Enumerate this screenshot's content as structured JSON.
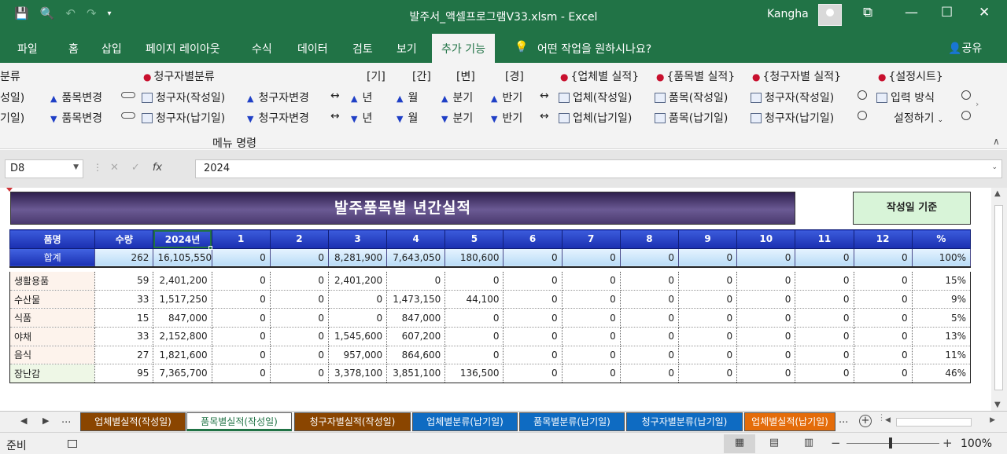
{
  "window": {
    "title": "발주서_액셀프로그램V33.xlsm  -  Excel",
    "user": "Kangha",
    "controls": [
      "ribbon-display-icon",
      "minimize-icon",
      "maximize-icon",
      "close-icon"
    ]
  },
  "qat": [
    "save-icon",
    "print-preview-icon",
    "undo-icon",
    "redo-icon",
    "customize-qat-icon"
  ],
  "ribbon_tabs": [
    "파일",
    "홈",
    "삽입",
    "페이지 레이아웃",
    "수식",
    "데이터",
    "검토",
    "보기",
    "추가 기능"
  ],
  "active_tab": "추가 기능",
  "tell_me": "어떤 작업을 원하시나요?",
  "share": "공유",
  "ribbon": {
    "partial_header": "분류",
    "partial_row1": "성일)",
    "partial_row2": "기일)",
    "item_change_up": "품목변경",
    "item_change_down": "품목변경",
    "client_category": "청구자별분류",
    "client_written": "청구자(작성일)",
    "client_delivery": "청구자(납기일)",
    "client_change_up": "청구자변경",
    "client_change_down": "청구자변경",
    "period_headers": [
      "[기]",
      "[간]",
      "[변]",
      "[경]"
    ],
    "period_up": [
      "년",
      "월",
      "분기",
      "반기"
    ],
    "period_down": [
      "년",
      "월",
      "분기",
      "반기"
    ],
    "vendor_perf": "{업체별 실적}",
    "item_perf": "{품목별 실적}",
    "client_perf": "{청구자별 실적}",
    "settings_sheet": "{설정시트}",
    "vendor_written": "업체(작성일)",
    "vendor_delivery": "업체(납기일)",
    "item_written": "품목(작성일)",
    "item_delivery": "품목(납기일)",
    "client_written2": "청구자(작성일)",
    "client_delivery2": "청구자(납기일)",
    "input_method": "입력 방식",
    "settings": "설정하기",
    "group_label": "메뉴 명령"
  },
  "formula_bar": {
    "name_box": "D8",
    "fx": "fx",
    "value": "2024"
  },
  "sheet": {
    "banner": "발주품목별 년간실적",
    "basis_button": "작성일 기준",
    "headers": [
      "품명",
      "수량",
      "2024년",
      "1",
      "2",
      "3",
      "4",
      "5",
      "6",
      "7",
      "8",
      "9",
      "10",
      "11",
      "12",
      "%"
    ],
    "total_row": [
      "합계",
      "262",
      "16,105,550",
      "0",
      "0",
      "8,281,900",
      "7,643,050",
      "180,600",
      "0",
      "0",
      "0",
      "0",
      "0",
      "0",
      "0",
      "100%"
    ],
    "rows": [
      [
        "생활용품",
        "59",
        "2,401,200",
        "0",
        "0",
        "2,401,200",
        "0",
        "0",
        "0",
        "0",
        "0",
        "0",
        "0",
        "0",
        "0",
        "15%"
      ],
      [
        "수산물",
        "33",
        "1,517,250",
        "0",
        "0",
        "0",
        "1,473,150",
        "44,100",
        "0",
        "0",
        "0",
        "0",
        "0",
        "0",
        "0",
        "9%"
      ],
      [
        "식품",
        "15",
        "847,000",
        "0",
        "0",
        "0",
        "847,000",
        "0",
        "0",
        "0",
        "0",
        "0",
        "0",
        "0",
        "0",
        "5%"
      ],
      [
        "야채",
        "33",
        "2,152,800",
        "0",
        "0",
        "1,545,600",
        "607,200",
        "0",
        "0",
        "0",
        "0",
        "0",
        "0",
        "0",
        "0",
        "13%"
      ],
      [
        "음식",
        "27",
        "1,821,600",
        "0",
        "0",
        "957,000",
        "864,600",
        "0",
        "0",
        "0",
        "0",
        "0",
        "0",
        "0",
        "0",
        "11%"
      ],
      [
        "장난감",
        "95",
        "7,365,700",
        "0",
        "0",
        "3,378,100",
        "3,851,100",
        "136,500",
        "0",
        "0",
        "0",
        "0",
        "0",
        "0",
        "0",
        "46%"
      ]
    ]
  },
  "sheet_tabs": [
    {
      "label": "업체별실적(작성일)",
      "color": "#8a4500"
    },
    {
      "label": "품목별실적(작성일)",
      "color": "#ffffff",
      "active": true
    },
    {
      "label": "청구자별실적(작성일)",
      "color": "#8a4500"
    },
    {
      "label": "업체별분류(납기일)",
      "color": "#0e6bc2"
    },
    {
      "label": "품목별분류(납기일)",
      "color": "#0e6bc2"
    },
    {
      "label": "청구자별분류(납기일)",
      "color": "#0e6bc2"
    },
    {
      "label": "업체별실적(납기일)",
      "color": "#e46c0a"
    }
  ],
  "tabs_more": "...",
  "status": {
    "ready": "준비",
    "zoom": "100%"
  }
}
